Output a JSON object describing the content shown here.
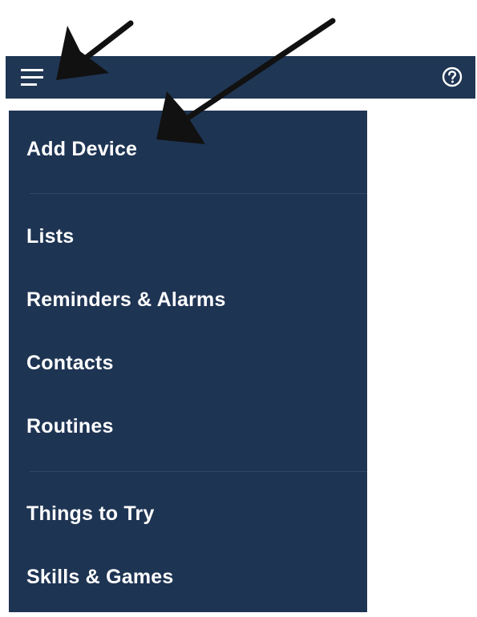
{
  "header": {
    "menu_icon": "hamburger-menu-icon",
    "help_icon": "question-circle-icon"
  },
  "drawer": {
    "items": [
      {
        "label": "Add Device"
      },
      {
        "label": "Lists"
      },
      {
        "label": "Reminders & Alarms"
      },
      {
        "label": "Contacts"
      },
      {
        "label": "Routines"
      },
      {
        "label": "Things to Try"
      },
      {
        "label": "Skills & Games"
      }
    ]
  },
  "annotations": {
    "arrow_icon": "black-arrow-pointer-icon"
  },
  "colors": {
    "navy": "#1f3654",
    "text": "#ffffff",
    "divider": "#2f4766",
    "arrow": "#111111"
  }
}
